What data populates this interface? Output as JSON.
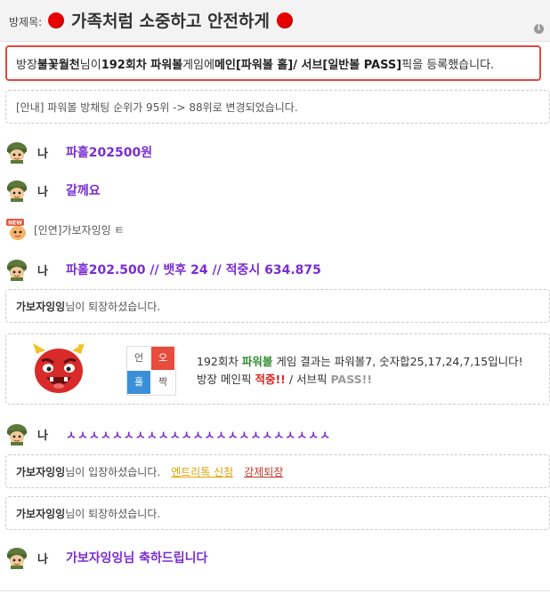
{
  "header": {
    "label": "방제목:",
    "title": "가족처럼 소중하고 안전하게",
    "info_glyph": "i",
    "dot_color": "#e80000"
  },
  "notice": {
    "p1": "방장 ",
    "host": "불꽃월천",
    "p2": "님이 ",
    "round": "192회차 파워볼",
    "p3": " 게임에 ",
    "main_pick": "메인[파워볼 홀]/ 서브[일반볼 PASS]",
    "p4": " 픽을 등록했습니다."
  },
  "rank_notice": "[안내] 파워볼 방채팅 순위가 95위 -> 88위로 변경되었습니다.",
  "chats": [
    {
      "icon": "soldier-avatar-icon",
      "name": "나",
      "text": "파홀202500원"
    },
    {
      "icon": "soldier-avatar-icon",
      "name": "나",
      "text": "갈께요"
    },
    {
      "icon": "new-avatar-icon",
      "name": "",
      "text": "[인연]가보자잉잉      ㅌ"
    },
    {
      "icon": "soldier-avatar-icon",
      "name": "나",
      "text": "파홀202.500 // 뱃후 24 // 적중시 634.875"
    },
    {
      "icon": "soldier-avatar-icon",
      "name": "나",
      "text": "ㅅㅅㅅㅅㅅㅅㅅㅅㅅㅅㅅㅅㅅㅅㅅㅅㅅㅅㅅㅅㅅㅅㅅ"
    },
    {
      "icon": "soldier-avatar-icon",
      "name": "나",
      "text": "가보자잉잉님 축하드립니다"
    }
  ],
  "system": {
    "leave1_user": "가보자잉잉",
    "leave1_text": "님이 퇴장하셨습니다.",
    "enter_user": "가보자잉잉",
    "enter_text": "님이 입장하셨습니다.",
    "entry_link": "엔트리톡 신청",
    "kick_link": "강제퇴장",
    "leave2_user": "가보자잉잉",
    "leave2_text": "님이 퇴장하셨습니다."
  },
  "result": {
    "grid": {
      "tl": "언",
      "tr": "오",
      "bl": "홀",
      "br": "짝"
    },
    "line1_a": "192회차 ",
    "line1_game": "파워볼",
    "line1_b": " 게임 결과는 파워볼7, 숫자합25,17,24,7,15입니다!",
    "line2_a": "방장 메인픽 ",
    "line2_hit": "적중!!",
    "line2_b": " / 서브픽 ",
    "line2_pass": "PASS!!"
  },
  "colors": {
    "chat_purple": "#7b2dd2",
    "notice_border": "#e0493c",
    "grid_red": "#e74c3c",
    "grid_blue": "#3a8fd8"
  }
}
